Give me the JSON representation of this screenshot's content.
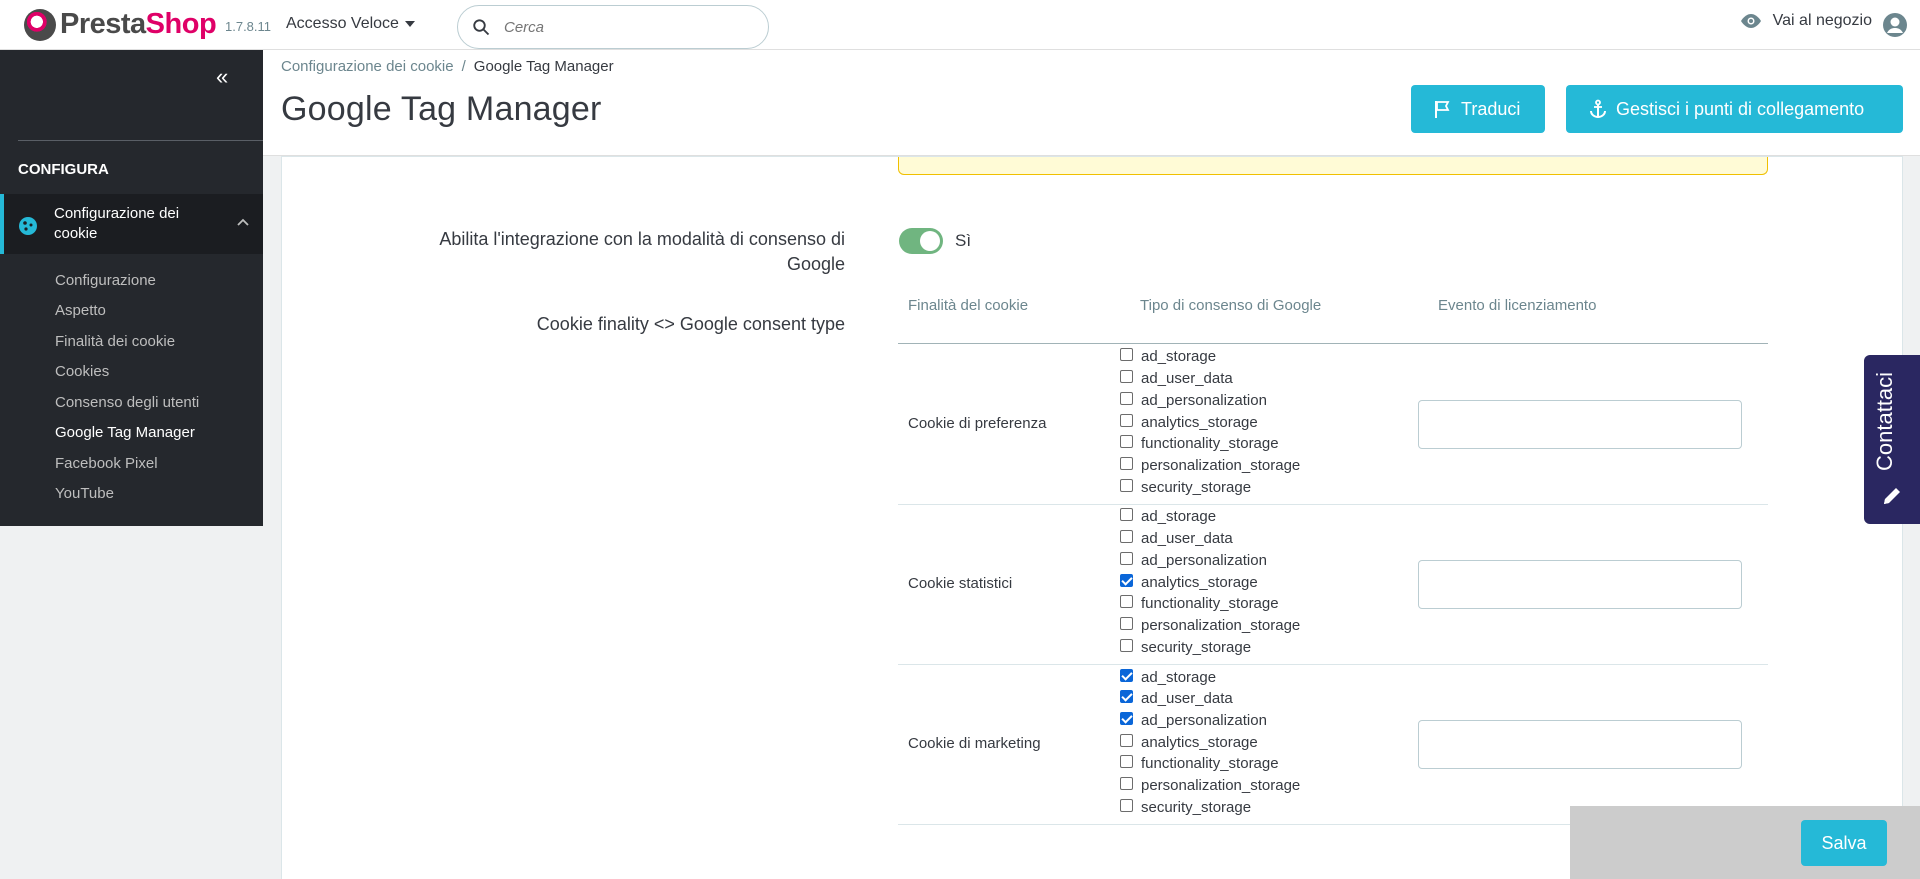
{
  "header": {
    "logo_part1": "Presta",
    "logo_part2": "Shop",
    "version": "1.7.8.11",
    "quick_access": "Accesso Veloce",
    "search_placeholder": "Cerca",
    "shop_link": "Vai al negozio"
  },
  "sidebar": {
    "section_title": "CONFIGURA",
    "active_menu": "Configurazione dei cookie",
    "items": [
      {
        "label": "Configurazione",
        "active": false
      },
      {
        "label": "Aspetto",
        "active": false
      },
      {
        "label": "Finalità dei cookie",
        "active": false
      },
      {
        "label": "Cookies",
        "active": false
      },
      {
        "label": "Consenso degli utenti",
        "active": false
      },
      {
        "label": "Google Tag Manager",
        "active": true
      },
      {
        "label": "Facebook Pixel",
        "active": false
      },
      {
        "label": "YouTube",
        "active": false
      }
    ]
  },
  "page": {
    "breadcrumb_parent": "Configurazione dei cookie",
    "breadcrumb_sep": "/",
    "breadcrumb_current": "Google Tag Manager",
    "title": "Google Tag Manager",
    "translate_button": "Traduci",
    "hooks_button": "Gestisci i punti di collegamento"
  },
  "form": {
    "consent_mode_label": "Abilita l'integrazione con la modalità di consenso di Google",
    "consent_mode_value": "Sì",
    "mapping_label": "Cookie finality <> Google consent type",
    "table": {
      "headers": [
        "Finalità del cookie",
        "Tipo di consenso di Google",
        "Evento di licenziamento"
      ],
      "rows": [
        {
          "finality": "Cookie di preferenza",
          "consents": [
            {
              "label": "ad_storage",
              "checked": false
            },
            {
              "label": "ad_user_data",
              "checked": false
            },
            {
              "label": "ad_personalization",
              "checked": false
            },
            {
              "label": "analytics_storage",
              "checked": false
            },
            {
              "label": "functionality_storage",
              "checked": false
            },
            {
              "label": "personalization_storage",
              "checked": false
            },
            {
              "label": "security_storage",
              "checked": false
            }
          ],
          "event": ""
        },
        {
          "finality": "Cookie statistici",
          "consents": [
            {
              "label": "ad_storage",
              "checked": false
            },
            {
              "label": "ad_user_data",
              "checked": false
            },
            {
              "label": "ad_personalization",
              "checked": false
            },
            {
              "label": "analytics_storage",
              "checked": true
            },
            {
              "label": "functionality_storage",
              "checked": false
            },
            {
              "label": "personalization_storage",
              "checked": false
            },
            {
              "label": "security_storage",
              "checked": false
            }
          ],
          "event": ""
        },
        {
          "finality": "Cookie di marketing",
          "consents": [
            {
              "label": "ad_storage",
              "checked": true
            },
            {
              "label": "ad_user_data",
              "checked": true
            },
            {
              "label": "ad_personalization",
              "checked": true
            },
            {
              "label": "analytics_storage",
              "checked": false
            },
            {
              "label": "functionality_storage",
              "checked": false
            },
            {
              "label": "personalization_storage",
              "checked": false
            },
            {
              "label": "security_storage",
              "checked": false
            }
          ],
          "event": ""
        }
      ]
    }
  },
  "contact_tab": "Contattaci",
  "save_button": "Salva",
  "colors": {
    "accent": "#25b9d7",
    "sidebar_dark": "#25282d",
    "toggle_on": "#70b580",
    "checkbox_on": "#0a66d8",
    "contact_tab": "#2a2761",
    "brand_pink": "#df0067"
  }
}
